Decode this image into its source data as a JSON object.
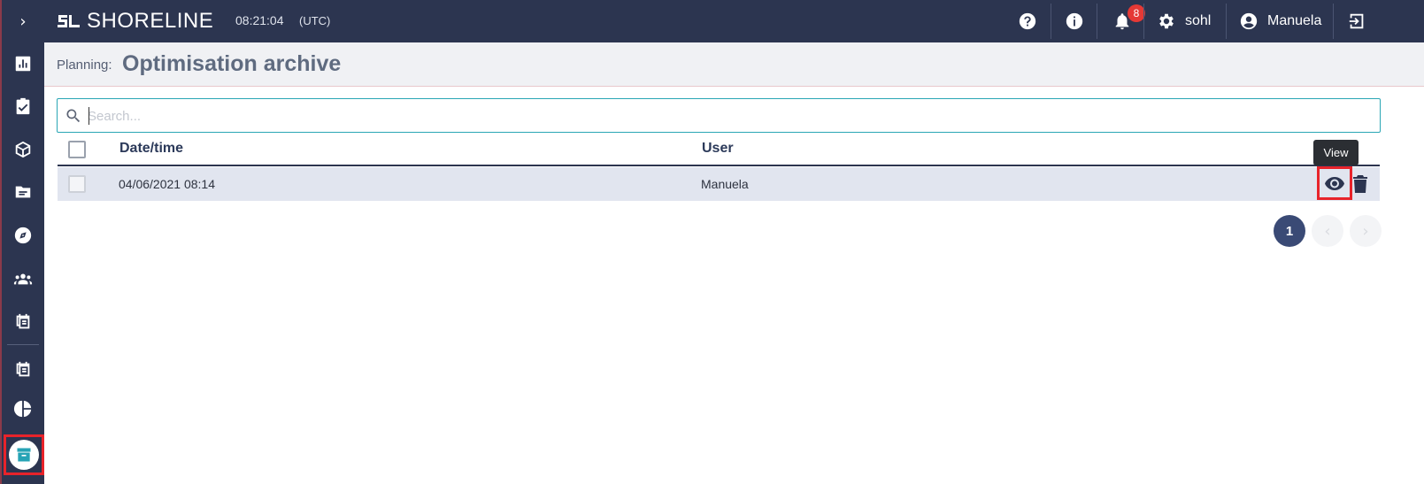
{
  "app": {
    "brand_prefix": "SL",
    "brand_name": "SHORELINE",
    "clock": "08:21:04",
    "timezone": "(UTC)"
  },
  "topbar": {
    "notifications_count": "8",
    "settings_label": "sohl",
    "user_label": "Manuela"
  },
  "sidebar": {
    "items": [
      {
        "icon": "bar-chart-icon"
      },
      {
        "icon": "clipboard-check-icon"
      },
      {
        "icon": "cube-icon"
      },
      {
        "icon": "folder-icon"
      },
      {
        "icon": "compass-icon"
      },
      {
        "icon": "people-icon"
      },
      {
        "icon": "calendar-list-icon"
      },
      {
        "icon": "calendar-list-icon"
      },
      {
        "icon": "pie-chart-icon"
      },
      {
        "icon": "archive-icon",
        "active": true
      }
    ],
    "active_color": "#26a3b5"
  },
  "page": {
    "breadcrumb": "Planning:",
    "title": "Optimisation archive"
  },
  "search": {
    "placeholder": "Search...",
    "value": ""
  },
  "table": {
    "columns": [
      "Date/time",
      "User"
    ],
    "rows": [
      {
        "datetime": "04/06/2021 08:14",
        "user": "Manuela",
        "selected": false
      }
    ]
  },
  "tooltip": {
    "text": "View"
  },
  "pagination": {
    "current_page": "1",
    "prev": "‹",
    "next": "›"
  },
  "colors": {
    "navbar": "#2c3550",
    "accent": "#26a3b5",
    "highlight": "#e8232a",
    "badge": "#e53935",
    "row_bg": "#e1e5ef"
  }
}
